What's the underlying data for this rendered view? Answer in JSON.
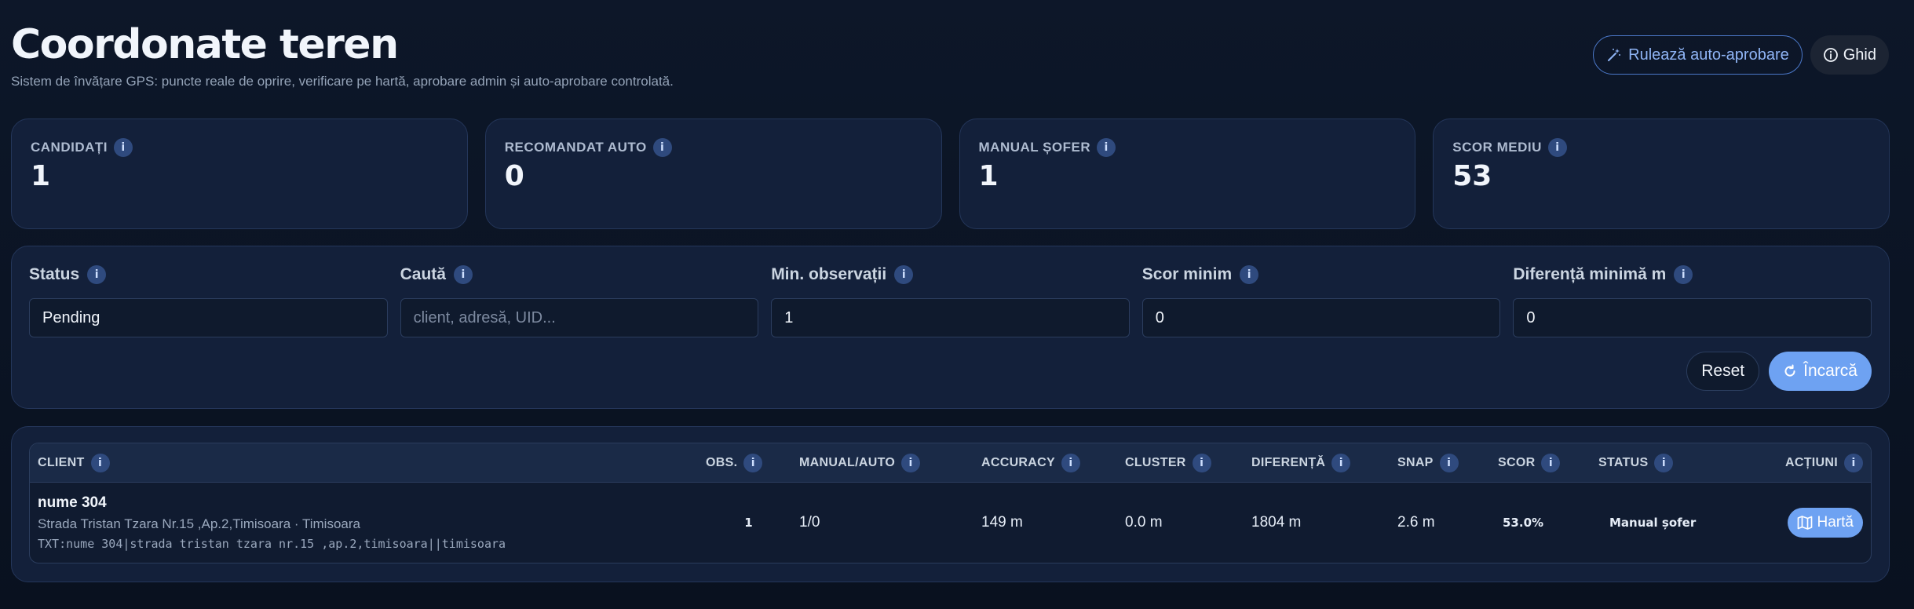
{
  "header": {
    "title": "Coordonate teren",
    "subtitle": "Sistem de învățare GPS: puncte reale de oprire, verificare pe hartă, aprobare admin și auto-aprobare controlată.",
    "auto_button": "Rulează auto-aprobare",
    "guide_button": "Ghid"
  },
  "stats": [
    {
      "label": "CANDIDAȚI",
      "value": "1"
    },
    {
      "label": "RECOMANDAT AUTO",
      "value": "0"
    },
    {
      "label": "MANUAL ȘOFER",
      "value": "1"
    },
    {
      "label": "SCOR MEDIU",
      "value": "53"
    }
  ],
  "filters": {
    "status": {
      "label": "Status",
      "value": "Pending"
    },
    "search": {
      "label": "Caută",
      "placeholder": "client, adresă, UID..."
    },
    "min_obs": {
      "label": "Min. observații",
      "value": "1"
    },
    "min_score": {
      "label": "Scor minim",
      "value": "0"
    },
    "min_diff": {
      "label": "Diferență minimă m",
      "value": "0"
    },
    "reset_button": "Reset",
    "load_button": "Încarcă"
  },
  "table": {
    "headers": [
      "CLIENT",
      "OBS.",
      "MANUAL/AUTO",
      "ACCURACY",
      "CLUSTER",
      "DIFERENȚĂ",
      "SNAP",
      "SCOR",
      "STATUS",
      "ACȚIUNI"
    ],
    "rows": [
      {
        "client_name": "nume 304",
        "client_address": "Strada Tristan Tzara Nr.15 ,Ap.2,Timisoara · Timisoara",
        "client_txt": "TXT:nume 304|strada tristan tzara nr.15 ,ap.2,timisoara||timisoara",
        "obs": "1",
        "manual_auto": "1/0",
        "accuracy": "149 m",
        "cluster": "0.0 m",
        "diff": "1804 m",
        "snap": "2.6 m",
        "score": "53.0%",
        "status": "Manual șofer",
        "action": "Hartă"
      }
    ]
  },
  "icons": {
    "info": "info-icon",
    "wand": "magic-wand-icon",
    "guide": "info-circle-icon",
    "refresh": "refresh-icon",
    "map": "map-icon"
  },
  "colors": {
    "background": "#0b1424",
    "card": "#13203a",
    "accent": "#6ea2f2",
    "accent_outline": "#4b78c9"
  }
}
